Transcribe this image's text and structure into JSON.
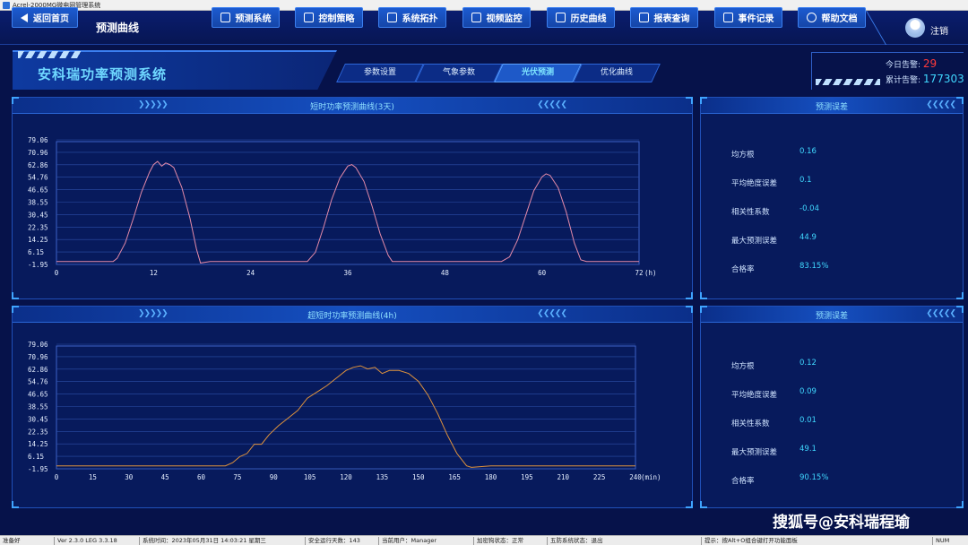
{
  "window": {
    "title": "Acrel-2000MG微电网管理系统"
  },
  "nav": {
    "back_label": "返回首页",
    "page_label": "预测曲线",
    "buttons": [
      "预测系统",
      "控制策略",
      "系统拓扑",
      "视频监控",
      "历史曲线",
      "报表查询",
      "事件记录",
      "帮助文档"
    ],
    "logout_label": "注销"
  },
  "header": {
    "system_title": "安科瑞功率预测系统",
    "tabs": [
      {
        "label": "参数设置",
        "active": false
      },
      {
        "label": "气象参数",
        "active": false
      },
      {
        "label": "光伏预测",
        "active": true
      },
      {
        "label": "优化曲线",
        "active": false
      }
    ],
    "alarm_today_label": "今日告警:",
    "alarm_today_value": "29",
    "alarm_total_label": "累计告警:",
    "alarm_total_value": "177303"
  },
  "short_term": {
    "title": "短时功率预测曲线(3天)",
    "chart_data": {
      "type": "line",
      "x_unit_label": "(h)",
      "x_ticks": [
        0,
        12,
        24,
        36,
        48,
        60,
        72
      ],
      "y_ticks": [
        "79.06",
        "70.96",
        "62.86",
        "54.76",
        "46.65",
        "38.55",
        "30.45",
        "22.35",
        "14.25",
        "6.15",
        "-1.95"
      ],
      "xlim": [
        0,
        72
      ],
      "ylim": [
        -1.95,
        79.06
      ],
      "color": "#e48aa8",
      "series": [
        {
          "points": [
            [
              0,
              0
            ],
            [
              7,
              0
            ],
            [
              7.5,
              2
            ],
            [
              8.5,
              12
            ],
            [
              9.5,
              28
            ],
            [
              10.5,
              45
            ],
            [
              11.5,
              58
            ],
            [
              12,
              63
            ],
            [
              12.5,
              65
            ],
            [
              13,
              62
            ],
            [
              13.5,
              64
            ],
            [
              14,
              63
            ],
            [
              14.5,
              61
            ],
            [
              15.5,
              48
            ],
            [
              16.5,
              28
            ],
            [
              17.3,
              8
            ],
            [
              17.8,
              -1
            ],
            [
              19,
              0
            ],
            [
              22,
              0
            ],
            [
              26,
              0
            ],
            [
              31,
              0
            ],
            [
              32,
              6
            ],
            [
              33,
              22
            ],
            [
              34,
              40
            ],
            [
              35,
              54
            ],
            [
              36,
              62
            ],
            [
              36.5,
              63
            ],
            [
              37,
              61
            ],
            [
              38,
              52
            ],
            [
              39,
              36
            ],
            [
              40,
              18
            ],
            [
              41,
              4
            ],
            [
              41.5,
              0
            ],
            [
              48,
              0
            ],
            [
              55,
              0
            ],
            [
              56,
              3
            ],
            [
              57,
              14
            ],
            [
              58,
              30
            ],
            [
              59,
              46
            ],
            [
              60,
              55
            ],
            [
              60.5,
              57
            ],
            [
              61,
              56
            ],
            [
              62,
              48
            ],
            [
              63,
              32
            ],
            [
              64,
              12
            ],
            [
              64.8,
              1
            ],
            [
              65.5,
              0
            ],
            [
              72,
              0
            ]
          ]
        }
      ]
    },
    "errors_title": "预测误差",
    "errors": [
      {
        "label": "均方根",
        "value": "0.16"
      },
      {
        "label": "平均绝度误差",
        "value": "0.1"
      },
      {
        "label": "相关性系数",
        "value": "-0.04"
      },
      {
        "label": "最大预测误差",
        "value": "44.9"
      },
      {
        "label": "合格率",
        "value": "83.15%"
      }
    ]
  },
  "ultra_short": {
    "title": "超短时功率预测曲线(4h)",
    "chart_data": {
      "type": "line",
      "x_unit_label": "(min)",
      "x_ticks": [
        0,
        15,
        30,
        45,
        60,
        75,
        90,
        105,
        120,
        135,
        150,
        165,
        180,
        195,
        210,
        225,
        240
      ],
      "y_ticks": [
        "79.06",
        "70.96",
        "62.86",
        "54.76",
        "46.65",
        "38.55",
        "30.45",
        "22.35",
        "14.25",
        "6.15",
        "-1.95"
      ],
      "xlim": [
        0,
        240
      ],
      "ylim": [
        -1.95,
        79.06
      ],
      "color": "#e0933c",
      "series": [
        {
          "points": [
            [
              0,
              0
            ],
            [
              70,
              0
            ],
            [
              73,
              2
            ],
            [
              76,
              6
            ],
            [
              79,
              8
            ],
            [
              82,
              14
            ],
            [
              85,
              14
            ],
            [
              88,
              20
            ],
            [
              92,
              26
            ],
            [
              96,
              31
            ],
            [
              100,
              36
            ],
            [
              104,
              44
            ],
            [
              108,
              48
            ],
            [
              112,
              52
            ],
            [
              116,
              57
            ],
            [
              120,
              62
            ],
            [
              123,
              64
            ],
            [
              126,
              65
            ],
            [
              129,
              63
            ],
            [
              132,
              64
            ],
            [
              135,
              60
            ],
            [
              138,
              62
            ],
            [
              142,
              62
            ],
            [
              146,
              60
            ],
            [
              150,
              55
            ],
            [
              154,
              46
            ],
            [
              158,
              34
            ],
            [
              162,
              20
            ],
            [
              166,
              8
            ],
            [
              170,
              0
            ],
            [
              172,
              -1
            ],
            [
              180,
              0
            ],
            [
              195,
              0
            ],
            [
              240,
              0
            ]
          ]
        }
      ]
    },
    "errors_title": "预测误差",
    "errors": [
      {
        "label": "均方根",
        "value": "0.12"
      },
      {
        "label": "平均绝度误差",
        "value": "0.09"
      },
      {
        "label": "相关性系数",
        "value": "0.01"
      },
      {
        "label": "最大预测误差",
        "value": "49.1"
      },
      {
        "label": "合格率",
        "value": "90.15%"
      }
    ]
  },
  "statusbar": {
    "ready": "准备好",
    "version": "Ver 2.3.0 LEG 3.3.18",
    "system_time": "系统时间：2023年05月31日  14:03:21   星期三",
    "safe_days": "安全运行天数：143",
    "current_user": "当前用户：Manager",
    "dog_status": "加密狗状态：正常",
    "five_defense": "五防系统状态：退出",
    "hint": "提示：按Alt+O组合键打开功能面板",
    "num": "NUM"
  },
  "watermark": "搜狐号@安科瑞程瑜"
}
